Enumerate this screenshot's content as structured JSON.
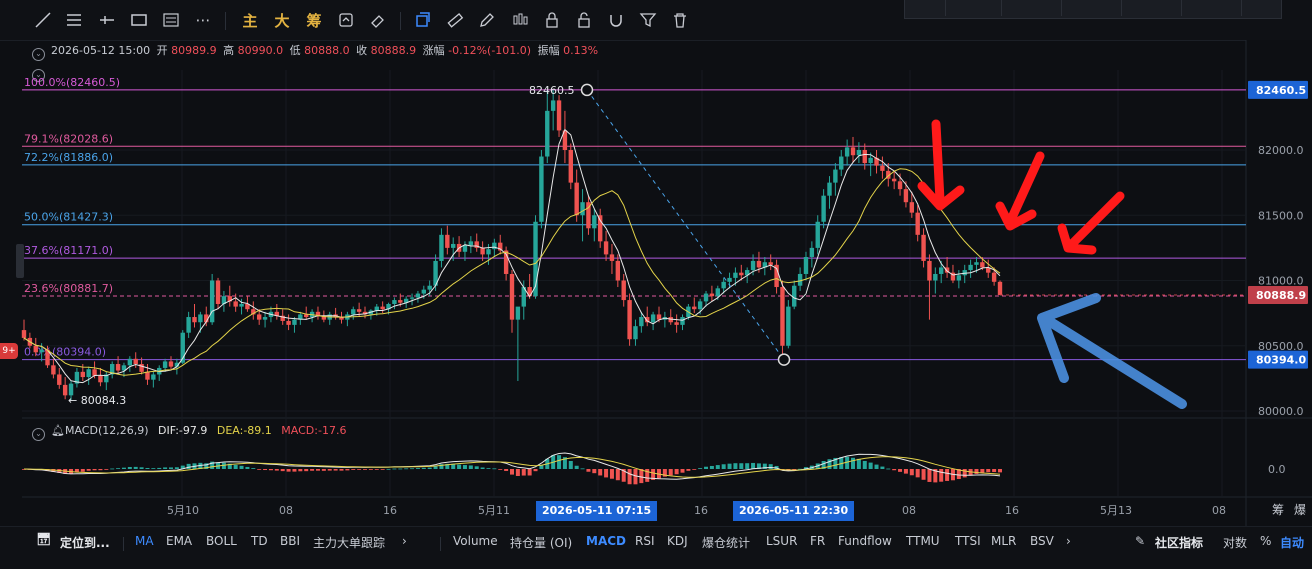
{
  "toolbar": {
    "tools": [
      "line-tool",
      "hline-tool",
      "hray-tool",
      "rect-tool",
      "channel-tool",
      "more-tool"
    ],
    "cn_main": "主",
    "cn_big": "大",
    "cn_chip": "筹",
    "right_tools": [
      "sync-tool",
      "eraser-tool",
      "drawing-mode-tool",
      "ruler-tool",
      "pen-tool",
      "candle-tool",
      "lock-tool",
      "magnet-tool",
      "filter-tool",
      "trash-tool"
    ]
  },
  "info": {
    "datetime": "2026-05-12 15:00",
    "open_label": "开",
    "open": "80989.9",
    "high_label": "高",
    "high": "80990.0",
    "low_label": "低",
    "low": "80888.0",
    "close_label": "收",
    "close": "80888.9",
    "change_label": "涨幅",
    "change": "-0.12%(-101.0)",
    "amp_label": "振幅",
    "amp": "0.13%"
  },
  "fib": [
    {
      "label": "100.0%(82460.5)",
      "value": 82460.5,
      "color": "#d65ad6"
    },
    {
      "label": "79.1%(82028.6)",
      "value": 82028.6,
      "color": "#e05a9e"
    },
    {
      "label": "72.2%(81886.0)",
      "value": 81886.0,
      "color": "#4aa3e8"
    },
    {
      "label": "50.0%(81427.3)",
      "value": 81427.3,
      "color": "#4aa3e8"
    },
    {
      "label": "37.6%(81171.0)",
      "value": 81171.0,
      "color": "#b05ae0"
    },
    {
      "label": "23.6%(80881.7)",
      "value": 80881.7,
      "color": "#e05a9e"
    },
    {
      "label": "0.0%(80394.0)",
      "value": 80394.0,
      "color": "#8a5ae0"
    }
  ],
  "price_axis": {
    "ticks": [
      "82000.0",
      "81500.0",
      "81000.0",
      "80500.0",
      "80000.0"
    ],
    "tick_values": [
      82000,
      81500,
      81000,
      80500,
      80000
    ],
    "tag_high": "82460.5",
    "tag_current": "80888.9",
    "tag_low": "80394.0",
    "macd_zero": "0.0"
  },
  "annotations": {
    "peak_label": "82460.5",
    "low_label": "← 80084.3"
  },
  "macd": {
    "title": "MACD(12,26,9)",
    "dif": "DIF:-97.9",
    "dea": "DEA:-89.1",
    "macd": "MACD:-17.6"
  },
  "time_axis": {
    "labels": [
      "5月10",
      "08",
      "16",
      "5月11",
      "16",
      "08",
      "16",
      "5月13",
      "08"
    ],
    "crosshair_1": "2026-05-11 07:15",
    "crosshair_2": "2026-05-11 22:30",
    "corner_1": "筹",
    "corner_2": "爆"
  },
  "bottom": {
    "locate": "定位到...",
    "indicators_main": [
      "MA",
      "EMA",
      "BOLL",
      "TD",
      "BBI",
      "主力大单跟踪"
    ],
    "indicators_sub": [
      "Volume",
      "持仓量 (OI)",
      "MACD",
      "RSI",
      "KDJ",
      "爆仓统计",
      "LSUR",
      "FR",
      "Fundflow",
      "TTMU",
      "TTSI",
      "MLR",
      "BSV"
    ],
    "community": "社区指标",
    "log": "对数",
    "percent": "%",
    "auto": "自动"
  },
  "badge": "9+",
  "colors": {
    "up": "#26a69a",
    "down": "#ef5350",
    "ma_fast": "#e8e8e8",
    "ma_slow": "#e3d34a",
    "accent": "#3d8bff",
    "tag_blue": "#1c64d6",
    "tag_red": "#c0404a",
    "arrow_red": "#ff1a1a",
    "arrow_blue": "#4a8fe0"
  },
  "chart_data": {
    "type": "candlestick",
    "price_range": [
      79950,
      82700
    ],
    "candles_ohlc_approx": [
      [
        80620,
        80700,
        80540,
        80560
      ],
      [
        80560,
        80600,
        80480,
        80500
      ],
      [
        80500,
        80560,
        80420,
        80450
      ],
      [
        80450,
        80520,
        80380,
        80470
      ],
      [
        80470,
        80500,
        80330,
        80350
      ],
      [
        80350,
        80400,
        80250,
        80280
      ],
      [
        80280,
        80330,
        80170,
        80200
      ],
      [
        80200,
        80260,
        80090,
        80120
      ],
      [
        80120,
        80230,
        80084,
        80210
      ],
      [
        80210,
        80330,
        80180,
        80300
      ],
      [
        80300,
        80360,
        80230,
        80260
      ],
      [
        80260,
        80340,
        80200,
        80320
      ],
      [
        80320,
        80380,
        80250,
        80270
      ],
      [
        80270,
        80330,
        80190,
        80220
      ],
      [
        80220,
        80300,
        80160,
        80280
      ],
      [
        80280,
        80380,
        80250,
        80360
      ],
      [
        80360,
        80420,
        80290,
        80310
      ],
      [
        80310,
        80370,
        80260,
        80350
      ],
      [
        80350,
        80420,
        80300,
        80400
      ],
      [
        80400,
        80450,
        80330,
        80360
      ],
      [
        80360,
        80410,
        80280,
        80300
      ],
      [
        80300,
        80360,
        80200,
        80240
      ],
      [
        80240,
        80300,
        80180,
        80280
      ],
      [
        80280,
        80350,
        80230,
        80330
      ],
      [
        80330,
        80400,
        80300,
        80380
      ],
      [
        80380,
        80420,
        80320,
        80340
      ],
      [
        80340,
        80400,
        80280,
        80370
      ],
      [
        80370,
        80620,
        80360,
        80600
      ],
      [
        80600,
        80760,
        80560,
        80720
      ],
      [
        80720,
        80820,
        80640,
        80680
      ],
      [
        80680,
        80760,
        80600,
        80740
      ],
      [
        80740,
        80800,
        80650,
        80680
      ],
      [
        80680,
        81050,
        80660,
        81000
      ],
      [
        81000,
        81020,
        80780,
        80820
      ],
      [
        80820,
        80920,
        80760,
        80880
      ],
      [
        80880,
        80960,
        80800,
        80840
      ],
      [
        80840,
        80900,
        80760,
        80800
      ],
      [
        80800,
        80860,
        80740,
        80820
      ],
      [
        80820,
        80880,
        80760,
        80780
      ],
      [
        80780,
        80840,
        80700,
        80740
      ],
      [
        80740,
        80780,
        80660,
        80700
      ],
      [
        80700,
        80760,
        80640,
        80720
      ],
      [
        80720,
        80800,
        80680,
        80760
      ],
      [
        80760,
        80820,
        80700,
        80730
      ],
      [
        80730,
        80780,
        80660,
        80690
      ],
      [
        80690,
        80740,
        80620,
        80660
      ],
      [
        80660,
        80720,
        80600,
        80700
      ],
      [
        80700,
        80760,
        80660,
        80740
      ],
      [
        80740,
        80800,
        80700,
        80720
      ],
      [
        80720,
        80780,
        80680,
        80760
      ],
      [
        80760,
        80800,
        80700,
        80730
      ],
      [
        80730,
        80770,
        80680,
        80700
      ],
      [
        80700,
        80760,
        80660,
        80740
      ],
      [
        80740,
        80790,
        80700,
        80720
      ],
      [
        80720,
        80760,
        80670,
        80700
      ],
      [
        80700,
        80760,
        80650,
        80740
      ],
      [
        80740,
        80800,
        80700,
        80780
      ],
      [
        80780,
        80830,
        80720,
        80760
      ],
      [
        80760,
        80800,
        80710,
        80740
      ],
      [
        80740,
        80780,
        80700,
        80770
      ],
      [
        80770,
        80820,
        80730,
        80800
      ],
      [
        80800,
        80840,
        80750,
        80780
      ],
      [
        80780,
        80830,
        80740,
        80820
      ],
      [
        80820,
        80870,
        80780,
        80850
      ],
      [
        80850,
        80900,
        80800,
        80830
      ],
      [
        80830,
        80880,
        80790,
        80860
      ],
      [
        80860,
        80900,
        80810,
        80870
      ],
      [
        80870,
        80920,
        80830,
        80900
      ],
      [
        80900,
        80960,
        80860,
        80930
      ],
      [
        80930,
        81000,
        80880,
        80960
      ],
      [
        80960,
        81200,
        80920,
        81150
      ],
      [
        81150,
        81400,
        81100,
        81350
      ],
      [
        81350,
        81420,
        81200,
        81250
      ],
      [
        81250,
        81330,
        81150,
        81280
      ],
      [
        81280,
        81340,
        81180,
        81220
      ],
      [
        81220,
        81300,
        81150,
        81270
      ],
      [
        81270,
        81340,
        81210,
        81300
      ],
      [
        81300,
        81360,
        81220,
        81250
      ],
      [
        81250,
        81300,
        81150,
        81200
      ],
      [
        81200,
        81280,
        81120,
        81240
      ],
      [
        81240,
        81320,
        81180,
        81290
      ],
      [
        81290,
        81350,
        81200,
        81230
      ],
      [
        81230,
        81260,
        81000,
        81050
      ],
      [
        81050,
        81080,
        80600,
        80700
      ],
      [
        80700,
        80760,
        80230,
        80800
      ],
      [
        80800,
        81000,
        80700,
        80950
      ],
      [
        80950,
        81050,
        80860,
        80880
      ],
      [
        80880,
        81500,
        80860,
        81450
      ],
      [
        81450,
        82000,
        81400,
        81950
      ],
      [
        81950,
        82460,
        81900,
        82300
      ],
      [
        82300,
        82460,
        82150,
        82380
      ],
      [
        82380,
        82420,
        82100,
        82150
      ],
      [
        82150,
        82300,
        81900,
        82000
      ],
      [
        82000,
        82050,
        81700,
        81750
      ],
      [
        81750,
        81850,
        81450,
        81500
      ],
      [
        81500,
        81700,
        81300,
        81600
      ],
      [
        81600,
        81650,
        81350,
        81400
      ],
      [
        81400,
        81550,
        81300,
        81500
      ],
      [
        81500,
        81550,
        81250,
        81300
      ],
      [
        81300,
        81380,
        81150,
        81200
      ],
      [
        81200,
        81280,
        81050,
        81150
      ],
      [
        81150,
        81200,
        80950,
        81000
      ],
      [
        81000,
        81050,
        80800,
        80850
      ],
      [
        80850,
        80900,
        80500,
        80550
      ],
      [
        80550,
        80700,
        80500,
        80650
      ],
      [
        80650,
        80760,
        80600,
        80720
      ],
      [
        80720,
        80800,
        80650,
        80680
      ],
      [
        80680,
        80760,
        80620,
        80740
      ],
      [
        80740,
        80800,
        80680,
        80700
      ],
      [
        80700,
        80760,
        80640,
        80720
      ],
      [
        80720,
        80780,
        80660,
        80680
      ],
      [
        80680,
        80740,
        80600,
        80660
      ],
      [
        80660,
        80740,
        80620,
        80720
      ],
      [
        80720,
        80820,
        80700,
        80800
      ],
      [
        80800,
        80870,
        80750,
        80780
      ],
      [
        80780,
        80860,
        80740,
        80840
      ],
      [
        80840,
        80920,
        80800,
        80900
      ],
      [
        80900,
        80960,
        80840,
        80880
      ],
      [
        80880,
        80960,
        80850,
        80940
      ],
      [
        80940,
        81020,
        80900,
        80990
      ],
      [
        80990,
        81060,
        80940,
        81020
      ],
      [
        81020,
        81100,
        80960,
        81060
      ],
      [
        81060,
        81120,
        81000,
        81040
      ],
      [
        81040,
        81100,
        80980,
        81080
      ],
      [
        81080,
        81200,
        81040,
        81150
      ],
      [
        81150,
        81220,
        81060,
        81100
      ],
      [
        81100,
        81180,
        81040,
        81140
      ],
      [
        81140,
        81200,
        81080,
        81120
      ],
      [
        81120,
        81160,
        80900,
        80950
      ],
      [
        80950,
        81000,
        80420,
        80500
      ],
      [
        80500,
        80850,
        80480,
        80800
      ],
      [
        80800,
        81000,
        80780,
        80960
      ],
      [
        80960,
        81100,
        80920,
        81050
      ],
      [
        81050,
        81220,
        81000,
        81180
      ],
      [
        81180,
        81300,
        81100,
        81250
      ],
      [
        81250,
        81500,
        81200,
        81450
      ],
      [
        81450,
        81700,
        81400,
        81650
      ],
      [
        81650,
        81800,
        81550,
        81750
      ],
      [
        81750,
        81900,
        81650,
        81850
      ],
      [
        81850,
        82000,
        81800,
        81950
      ],
      [
        81950,
        82080,
        81880,
        82020
      ],
      [
        82020,
        82100,
        81900,
        81960
      ],
      [
        81960,
        82060,
        81900,
        82000
      ],
      [
        82000,
        82050,
        81850,
        81900
      ],
      [
        81900,
        81980,
        81800,
        81940
      ],
      [
        81940,
        82000,
        81820,
        81880
      ],
      [
        81880,
        81950,
        81780,
        81840
      ],
      [
        81840,
        81900,
        81720,
        81780
      ],
      [
        81780,
        81840,
        81700,
        81760
      ],
      [
        81760,
        81820,
        81650,
        81700
      ],
      [
        81700,
        81760,
        81560,
        81600
      ],
      [
        81600,
        81680,
        81480,
        81520
      ],
      [
        81520,
        81580,
        81300,
        81350
      ],
      [
        81350,
        81400,
        81100,
        81150
      ],
      [
        81150,
        81200,
        80700,
        81000
      ],
      [
        81000,
        81100,
        80900,
        81050
      ],
      [
        81050,
        81150,
        80980,
        81100
      ],
      [
        81100,
        81180,
        81020,
        81060
      ],
      [
        81060,
        81120,
        80980,
        81000
      ],
      [
        81000,
        81080,
        80940,
        81040
      ],
      [
        81040,
        81120,
        80980,
        81080
      ],
      [
        81080,
        81160,
        81020,
        81120
      ],
      [
        81120,
        81180,
        81060,
        81140
      ],
      [
        81140,
        81180,
        81080,
        81100
      ],
      [
        81100,
        81160,
        81020,
        81060
      ],
      [
        81060,
        81100,
        80960,
        80990
      ],
      [
        80990,
        81000,
        80888,
        80889
      ]
    ],
    "fib_levels": [
      82460.5,
      82028.6,
      81886.0,
      81427.3,
      81171.0,
      80881.7,
      80394.0
    ]
  }
}
